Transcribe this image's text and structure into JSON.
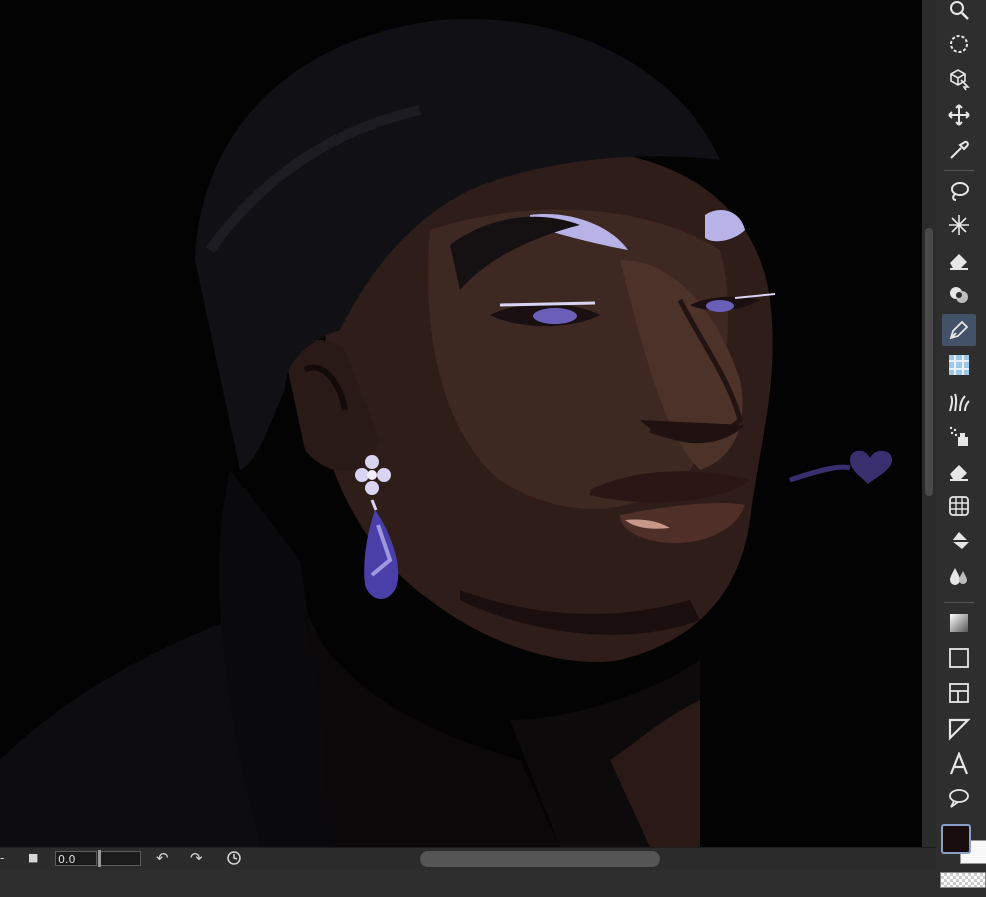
{
  "canvas": {
    "description_icon": "digital-portrait-artwork"
  },
  "toolbar": {
    "tools": [
      {
        "name": "zoom-tool",
        "icon": "magnifier-icon"
      },
      {
        "name": "rotate-view-tool",
        "icon": "rotate-dashed-circle-icon"
      },
      {
        "name": "object-select-tool",
        "icon": "cube-cursor-icon"
      },
      {
        "name": "move-tool",
        "icon": "move-arrows-icon"
      },
      {
        "name": "eyedropper-tool",
        "icon": "eyedropper-icon"
      },
      {
        "name": "lasso-selection-tool",
        "icon": "lasso-icon"
      },
      {
        "name": "magic-wand-tool",
        "icon": "magic-wand-icon"
      },
      {
        "name": "eraser-tool",
        "icon": "eraser-icon"
      },
      {
        "name": "blend-tool",
        "icon": "blend-blob-icon"
      },
      {
        "name": "pen-tool",
        "icon": "pen-nib-icon",
        "active": true
      },
      {
        "name": "pattern-tool",
        "icon": "pattern-tile-icon"
      },
      {
        "name": "decoration-tool",
        "icon": "grass-brush-icon"
      },
      {
        "name": "airbrush-tool",
        "icon": "airbrush-icon"
      },
      {
        "name": "eraser-tool-2",
        "icon": "eraser-icon"
      },
      {
        "name": "grid-tool",
        "icon": "grid-perspective-icon"
      },
      {
        "name": "fill-tool",
        "icon": "paint-bucket-icon"
      },
      {
        "name": "blur-tool",
        "icon": "water-drops-icon"
      },
      {
        "name": "gradient-tool",
        "icon": "gradient-square-icon"
      },
      {
        "name": "rectangle-tool",
        "icon": "rectangle-icon"
      },
      {
        "name": "frame-tool",
        "icon": "frame-panel-icon"
      },
      {
        "name": "ruler-tool",
        "icon": "ruler-triangle-icon"
      },
      {
        "name": "text-tool",
        "icon": "text-A-icon"
      },
      {
        "name": "balloon-tool",
        "icon": "speech-balloon-icon"
      }
    ],
    "colors": {
      "foreground": "#1a0d0d",
      "background": "#f8f8f8"
    }
  },
  "timeline": {
    "stop_glyph": "■",
    "frame_value": "0.0",
    "undo_glyph": "↶",
    "redo_glyph": "↷",
    "left_glyph": "-"
  },
  "colors": {
    "canvas_bg": "#030303",
    "panel_bg": "#2e2e2e",
    "active_tool": "#435269",
    "skin_dark": "#2f1d1a",
    "skin_mid": "#3e2822",
    "skin_light": "#5a3a30",
    "durag": "#101013",
    "lavender": "#b7b3e6",
    "purple_gem": "#4a3fa8"
  }
}
